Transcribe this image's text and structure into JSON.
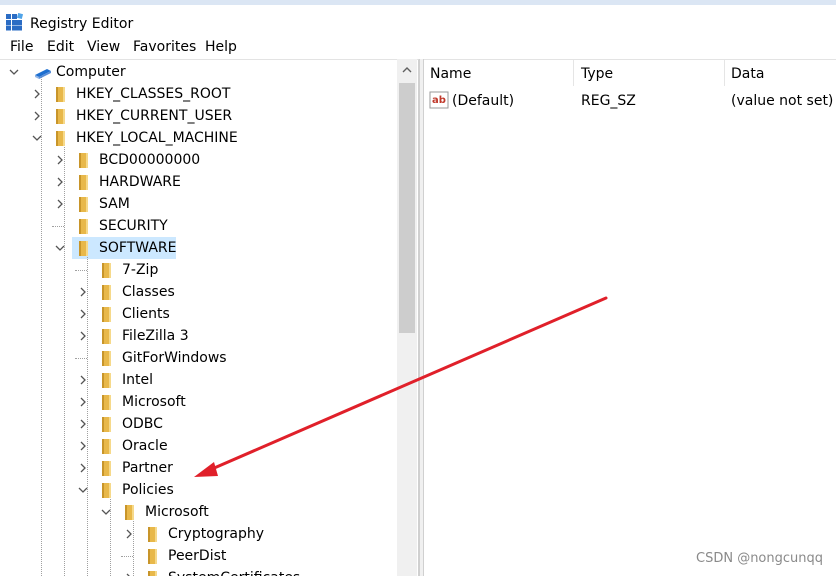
{
  "window": {
    "title": "Registry Editor"
  },
  "menu": [
    "File",
    "Edit",
    "View",
    "Favorites",
    "Help"
  ],
  "tree": [
    {
      "label": "Computer",
      "icon": "computer-icon",
      "toggle": "expanded"
    },
    {
      "label": "HKEY_CLASSES_ROOT",
      "toggle": "collapsed"
    },
    {
      "label": "HKEY_CURRENT_USER",
      "toggle": "collapsed"
    },
    {
      "label": "HKEY_LOCAL_MACHINE",
      "toggle": "expanded"
    },
    {
      "label": "BCD00000000",
      "toggle": "collapsed"
    },
    {
      "label": "HARDWARE",
      "toggle": "collapsed"
    },
    {
      "label": "SAM",
      "toggle": "collapsed"
    },
    {
      "label": "SECURITY",
      "toggle": "none"
    },
    {
      "label": "SOFTWARE",
      "toggle": "expanded",
      "selected": true
    },
    {
      "label": "7-Zip",
      "toggle": "none"
    },
    {
      "label": "Classes",
      "toggle": "collapsed"
    },
    {
      "label": "Clients",
      "toggle": "collapsed"
    },
    {
      "label": "FileZilla 3",
      "toggle": "collapsed"
    },
    {
      "label": "GitForWindows",
      "toggle": "none"
    },
    {
      "label": "Intel",
      "toggle": "collapsed"
    },
    {
      "label": "Microsoft",
      "toggle": "collapsed"
    },
    {
      "label": "ODBC",
      "toggle": "collapsed"
    },
    {
      "label": "Oracle",
      "toggle": "collapsed"
    },
    {
      "label": "Partner",
      "toggle": "collapsed"
    },
    {
      "label": "Policies",
      "toggle": "expanded"
    },
    {
      "label": "Microsoft",
      "toggle": "expanded"
    },
    {
      "label": "Cryptography",
      "toggle": "collapsed"
    },
    {
      "label": "PeerDist",
      "toggle": "none"
    },
    {
      "label": "SystemCertificates",
      "toggle": "collapsed"
    }
  ],
  "list": {
    "columns": [
      "Name",
      "Type",
      "Data"
    ],
    "rows": [
      {
        "name": "(Default)",
        "type": "REG_SZ",
        "data": "(value not set)",
        "icon": "string-value-icon"
      }
    ]
  },
  "annotation": {
    "arrow_color": "#e0202a"
  },
  "watermark": "CSDN @nongcunqq",
  "colors": {
    "selection": "#cce8ff",
    "folder": "#e8b84a",
    "accent": "#1e6fd0"
  }
}
